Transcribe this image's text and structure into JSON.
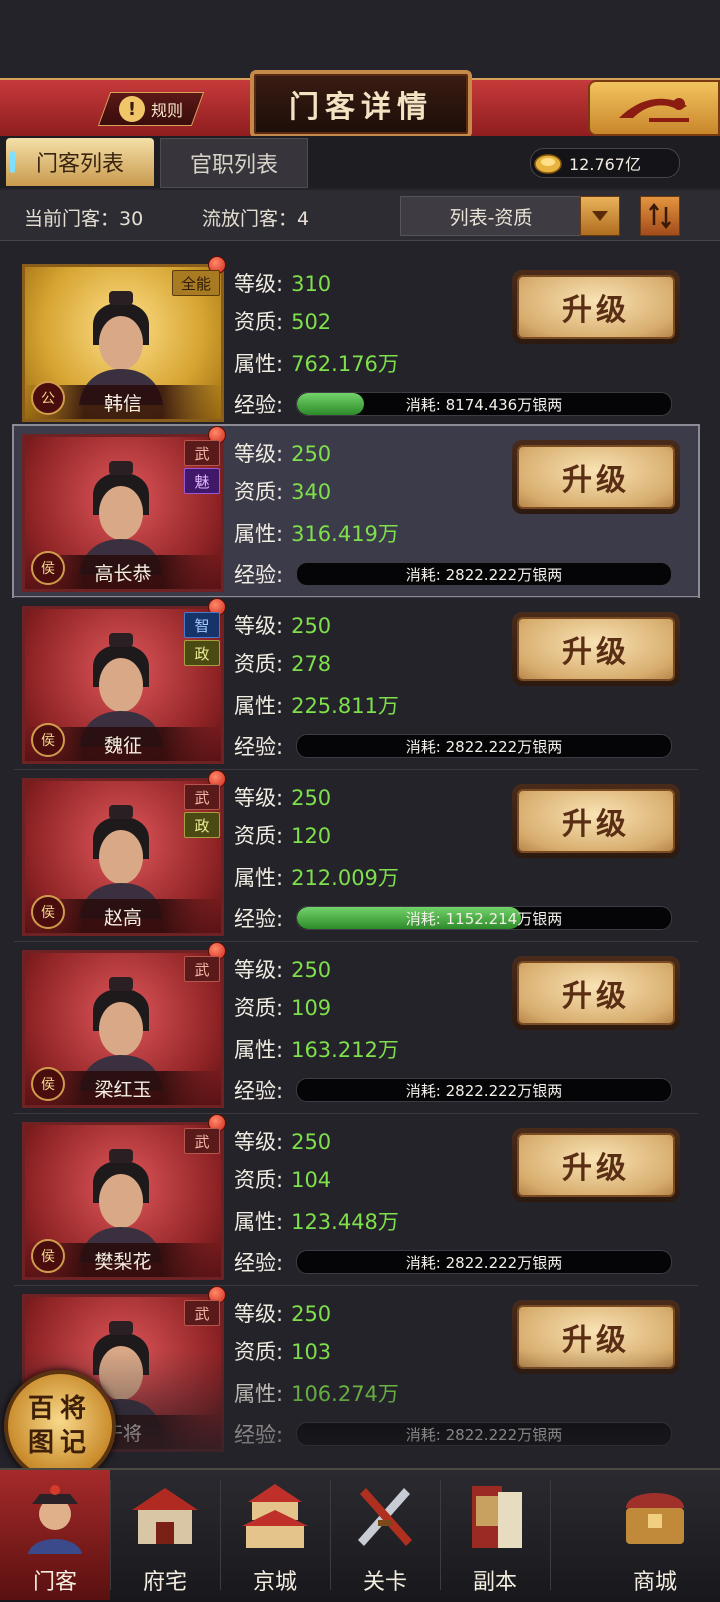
{
  "header": {
    "title": "门客详情",
    "rules_label": "规则"
  },
  "tabs": [
    {
      "label": "门客列表",
      "active": true
    },
    {
      "label": "官职列表",
      "active": false
    }
  ],
  "currency": {
    "value": "12.767亿",
    "icon": "gold-coin-icon"
  },
  "info": {
    "current_label": "当前门客：",
    "current_count": "30",
    "exiled_label": "流放门客：",
    "exiled_count": "4",
    "sort_select": "列表-资质"
  },
  "labels": {
    "level": "等级:",
    "quality": "资质:",
    "attribute": "属性:",
    "exp": "经验:",
    "upgrade": "升级",
    "consume": "消耗:"
  },
  "retainers": [
    {
      "name": "韩信",
      "rank": "公",
      "tags": [
        "全能"
      ],
      "level": "310",
      "quality": "502",
      "attribute": "762.176万",
      "cost": "8174.436万银两",
      "exp_fraction": 0.18,
      "portrait_style": "gold"
    },
    {
      "name": "高长恭",
      "rank": "侯",
      "tags": [
        "武",
        "魅"
      ],
      "level": "250",
      "quality": "340",
      "attribute": "316.419万",
      "cost": "2822.222万银两",
      "exp_fraction": 0,
      "portrait_style": "red"
    },
    {
      "name": "魏征",
      "rank": "侯",
      "tags": [
        "智",
        "政"
      ],
      "level": "250",
      "quality": "278",
      "attribute": "225.811万",
      "cost": "2822.222万银两",
      "exp_fraction": 0,
      "portrait_style": "red"
    },
    {
      "name": "赵高",
      "rank": "侯",
      "tags": [
        "武",
        "政"
      ],
      "level": "250",
      "quality": "120",
      "attribute": "212.009万",
      "cost": "1152.214万银两",
      "exp_fraction": 0.6,
      "portrait_style": "red"
    },
    {
      "name": "梁红玉",
      "rank": "侯",
      "tags": [
        "武"
      ],
      "level": "250",
      "quality": "109",
      "attribute": "163.212万",
      "cost": "2822.222万银两",
      "exp_fraction": 0,
      "portrait_style": "red"
    },
    {
      "name": "樊梨花",
      "rank": "侯",
      "tags": [
        "武"
      ],
      "level": "250",
      "quality": "104",
      "attribute": "123.448万",
      "cost": "2822.222万银两",
      "exp_fraction": 0,
      "portrait_style": "red"
    },
    {
      "name": "干将",
      "rank": "侯",
      "tags": [
        "武"
      ],
      "level": "250",
      "quality": "103",
      "attribute": "106.274万",
      "cost": "2822.222万银两",
      "exp_fraction": 0,
      "portrait_style": "red"
    }
  ],
  "floating_button": "百将图记",
  "bottom_nav": [
    {
      "label": "门客",
      "icon": "official-avatar-icon",
      "active": true
    },
    {
      "label": "府宅",
      "icon": "mansion-icon",
      "active": false
    },
    {
      "label": "京城",
      "icon": "palace-icon",
      "active": false
    },
    {
      "label": "关卡",
      "icon": "swords-icon",
      "active": false
    },
    {
      "label": "副本",
      "icon": "scroll-book-icon",
      "active": false
    },
    {
      "label": "商城",
      "icon": "treasure-chest-icon",
      "active": false
    }
  ],
  "colors": {
    "value_green": "#7ee04a",
    "header_red": "#c63a3a",
    "gold_button": "#d7ad6e"
  }
}
